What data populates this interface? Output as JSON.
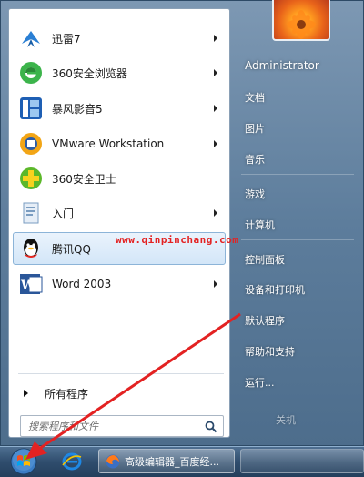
{
  "programs": [
    {
      "label": "迅雷7",
      "icon": "thunder-icon",
      "has_arrow": true
    },
    {
      "label": "360安全浏览器",
      "icon": "360-browser-icon",
      "has_arrow": true
    },
    {
      "label": "暴风影音5",
      "icon": "baofeng-icon",
      "has_arrow": true
    },
    {
      "label": "VMware Workstation",
      "icon": "vmware-icon",
      "has_arrow": true
    },
    {
      "label": "360安全卫士",
      "icon": "360-guard-icon",
      "has_arrow": false
    },
    {
      "label": "入门",
      "icon": "getting-started-icon",
      "has_arrow": true
    },
    {
      "label": "腾讯QQ",
      "icon": "qq-icon",
      "has_arrow": false,
      "highlighted": true
    },
    {
      "label": "Word 2003",
      "icon": "word-icon",
      "has_arrow": true
    }
  ],
  "all_programs_label": "所有程序",
  "search": {
    "placeholder": "搜索程序和文件"
  },
  "right_pane": [
    {
      "label": "Administrator"
    },
    {
      "label": "文档"
    },
    {
      "label": "图片"
    },
    {
      "label": "音乐"
    },
    {
      "label": "游戏"
    },
    {
      "label": "计算机"
    },
    {
      "label": "控制面板"
    },
    {
      "label": "设备和打印机"
    },
    {
      "label": "默认程序"
    },
    {
      "label": "帮助和支持"
    },
    {
      "label": "运行..."
    }
  ],
  "shutdown_label": "关机",
  "watermark": "www.qinpinchang.com",
  "taskbar": {
    "task_label": "高级编辑器_百度经..."
  },
  "colors": {
    "annotation_arrow": "#e32222",
    "hover_bg": "#d3e6f8"
  }
}
